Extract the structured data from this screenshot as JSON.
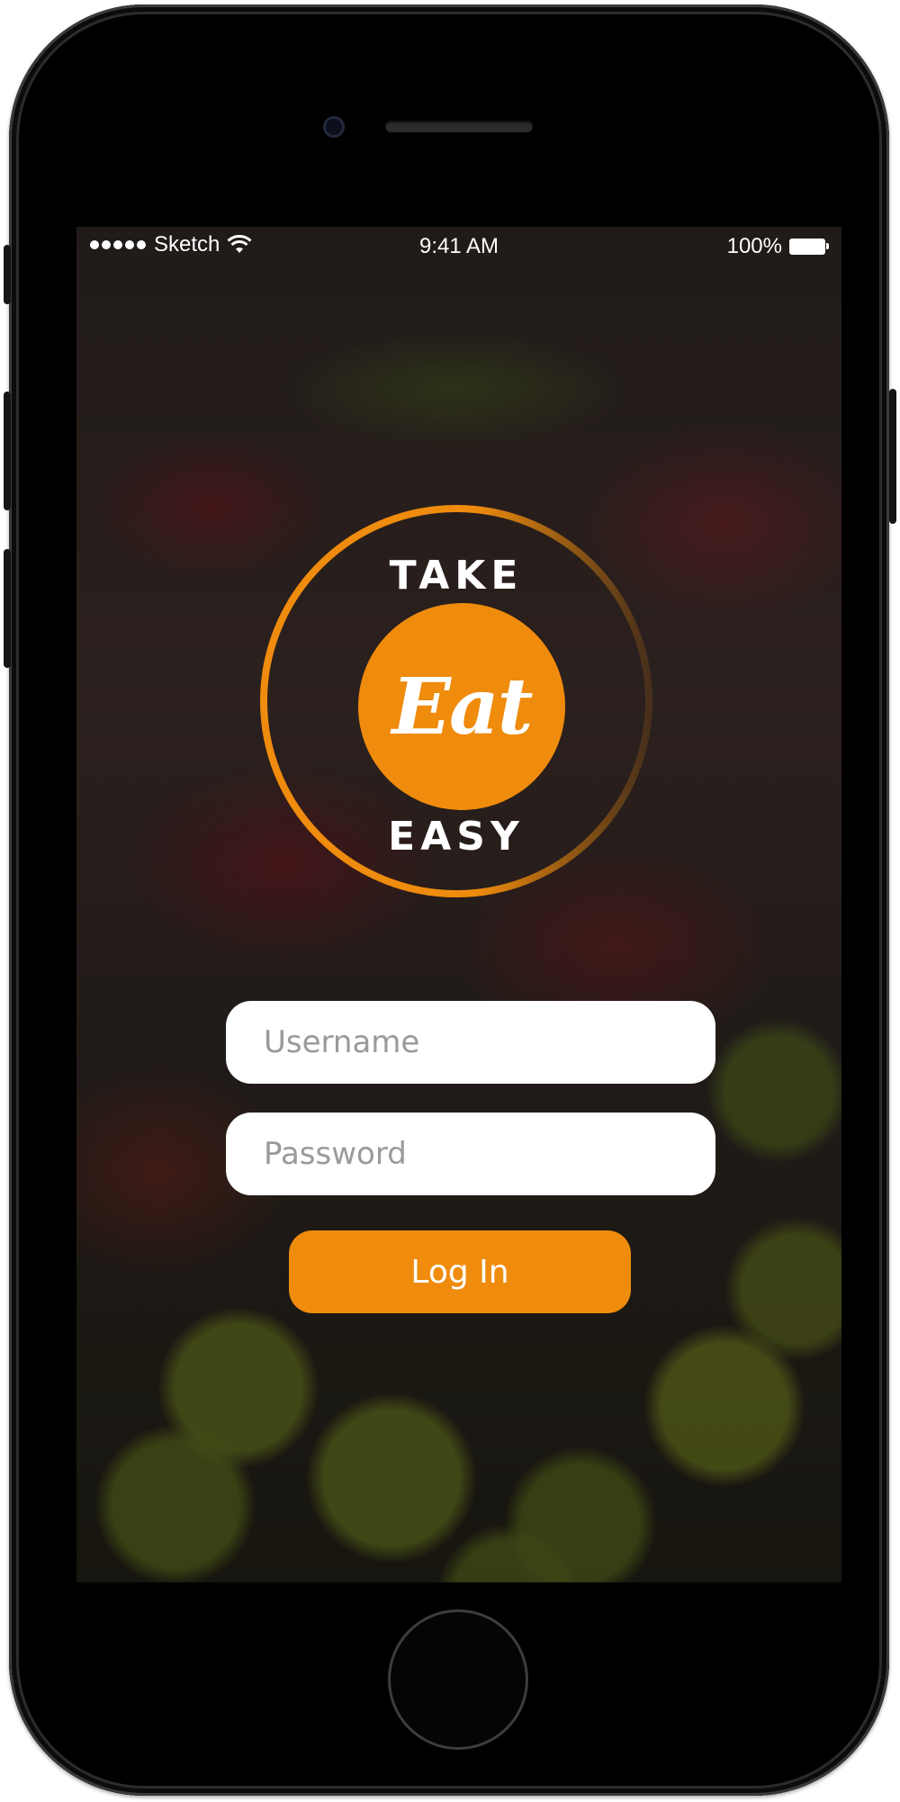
{
  "status_bar": {
    "carrier": "Sketch",
    "time": "9:41 AM",
    "battery": "100%"
  },
  "logo": {
    "top_text": "TAKE",
    "center_text": "Eat",
    "bottom_text": "EASY"
  },
  "login_form": {
    "username_placeholder": "Username",
    "password_placeholder": "Password",
    "submit_label": "Log In"
  },
  "colors": {
    "accent": "#ef8b0d",
    "field_background": "#ffffff",
    "placeholder_text": "#9a9a9a"
  }
}
